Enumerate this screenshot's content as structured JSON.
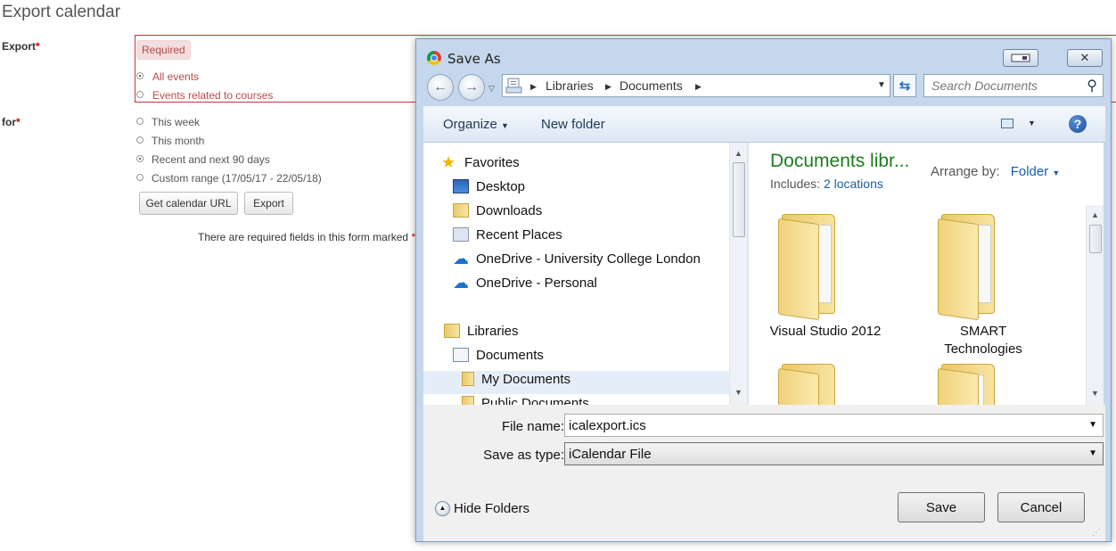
{
  "page": {
    "title": "Export calendar",
    "export_label": "Export",
    "for_label": "for",
    "required_marker": "*",
    "required_badge": "Required",
    "export_options": [
      "All events",
      "Events related to courses"
    ],
    "for_options": [
      "This week",
      "This month",
      "Recent and next 90 days",
      "Custom range (17/05/17 - 22/05/18)"
    ],
    "for_selected": "Recent and next 90 days",
    "get_url_button": "Get calendar URL",
    "export_button": "Export",
    "required_note": "There are required fields in this form marked",
    "required_note_star": "*",
    "required_note_dot": "."
  },
  "dialog": {
    "title": "Save As",
    "breadcrumb": [
      "Libraries",
      "Documents"
    ],
    "search_placeholder": "Search Documents",
    "toolbar": {
      "organize": "Organize",
      "new_folder": "New folder"
    },
    "nav": {
      "favorites": "Favorites",
      "favorites_items": [
        "Desktop",
        "Downloads",
        "Recent Places",
        "OneDrive - University College London",
        "OneDrive - Personal"
      ],
      "libraries": "Libraries",
      "selected": "Documents",
      "documents_children": [
        "My Documents",
        "Public Documents"
      ]
    },
    "content": {
      "library_title": "Documents libr...",
      "includes_label": "Includes:",
      "includes_link": "2 locations",
      "arrange_label": "Arrange by:",
      "arrange_value": "Folder",
      "folders": [
        "Visual Studio 2012",
        "SMART Technologies"
      ]
    },
    "filename_label": "File name:",
    "filename_value": "icalexport.ics",
    "saveas_label": "Save as type:",
    "saveas_value": "iCalendar File",
    "hide_folders": "Hide Folders",
    "save_button": "Save",
    "cancel_button": "Cancel"
  },
  "colors": {
    "required_red": "#c00000",
    "library_green": "#1e7b1e",
    "link_blue": "#1a5fa8",
    "dialog_frame": "#c4d7ec"
  }
}
